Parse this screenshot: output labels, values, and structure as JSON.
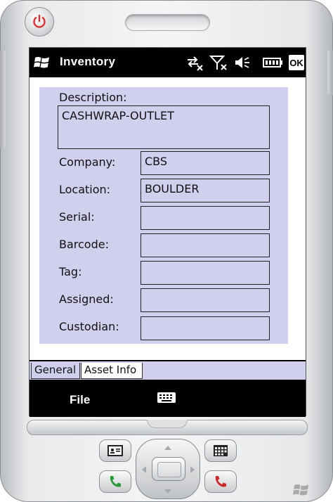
{
  "titlebar": {
    "app_title": "Inventory",
    "ok_label": "OK",
    "icons": [
      "windows-start-icon",
      "connectivity-icon",
      "signal-off-icon",
      "volume-icon",
      "battery-icon"
    ]
  },
  "form": {
    "description": {
      "label": "Description:",
      "value": "CASHWRAP-OUTLET"
    },
    "company": {
      "label": "Company:",
      "value": "CBS"
    },
    "location": {
      "label": "Location:",
      "value": "BOULDER"
    },
    "serial": {
      "label": "Serial:",
      "value": ""
    },
    "barcode": {
      "label": "Barcode:",
      "value": ""
    },
    "tag": {
      "label": "Tag:",
      "value": ""
    },
    "assigned": {
      "label": "Assigned:",
      "value": ""
    },
    "custodian": {
      "label": "Custodian:",
      "value": ""
    }
  },
  "tabs": [
    {
      "label": "General",
      "selected": false
    },
    {
      "label": "Asset Info",
      "selected": true
    }
  ],
  "softkeys": {
    "left": "File"
  },
  "colors": {
    "panel_bg": "#d0d0ee",
    "bar_bg": "#000000",
    "power_red": "#e03030",
    "call_green": "#2a9a3a",
    "end_red": "#d02828"
  }
}
